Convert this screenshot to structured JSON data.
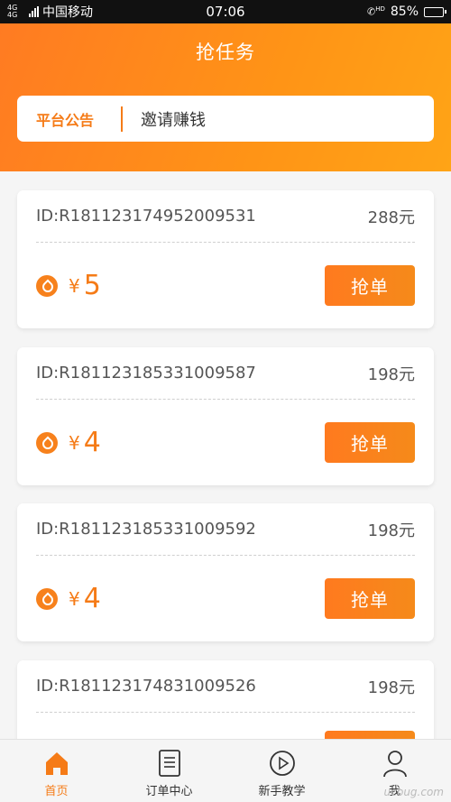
{
  "status_bar": {
    "network": "4G 4G",
    "carrier": "中国移动",
    "time": "07:06",
    "battery": "85%",
    "battery_level": 0.85,
    "hd_label": "HD"
  },
  "header": {
    "title": "抢任务",
    "notice_tag": "平台公告",
    "notice_text": "邀请赚钱"
  },
  "tasks": [
    {
      "id": "ID:R181123174952009531",
      "price": "288元",
      "reward_symbol": "¥",
      "reward": "5",
      "button": "抢单"
    },
    {
      "id": "ID:R181123185331009587",
      "price": "198元",
      "reward_symbol": "¥",
      "reward": "4",
      "button": "抢单"
    },
    {
      "id": "ID:R181123185331009592",
      "price": "198元",
      "reward_symbol": "¥",
      "reward": "4",
      "button": "抢单"
    },
    {
      "id": "ID:R181123174831009526",
      "price": "198元",
      "reward_symbol": "¥",
      "reward": "",
      "button": ""
    }
  ],
  "tabs": [
    {
      "label": "首页",
      "icon": "home-icon",
      "active": true
    },
    {
      "label": "订单中心",
      "icon": "document-icon",
      "active": false
    },
    {
      "label": "新手教学",
      "icon": "play-icon",
      "active": false
    },
    {
      "label": "我",
      "icon": "user-icon",
      "active": false
    }
  ],
  "colors": {
    "accent": "#f57b17",
    "header_start": "#ff7b22",
    "header_end": "#ffa416"
  },
  "watermark": "ucbug.com"
}
